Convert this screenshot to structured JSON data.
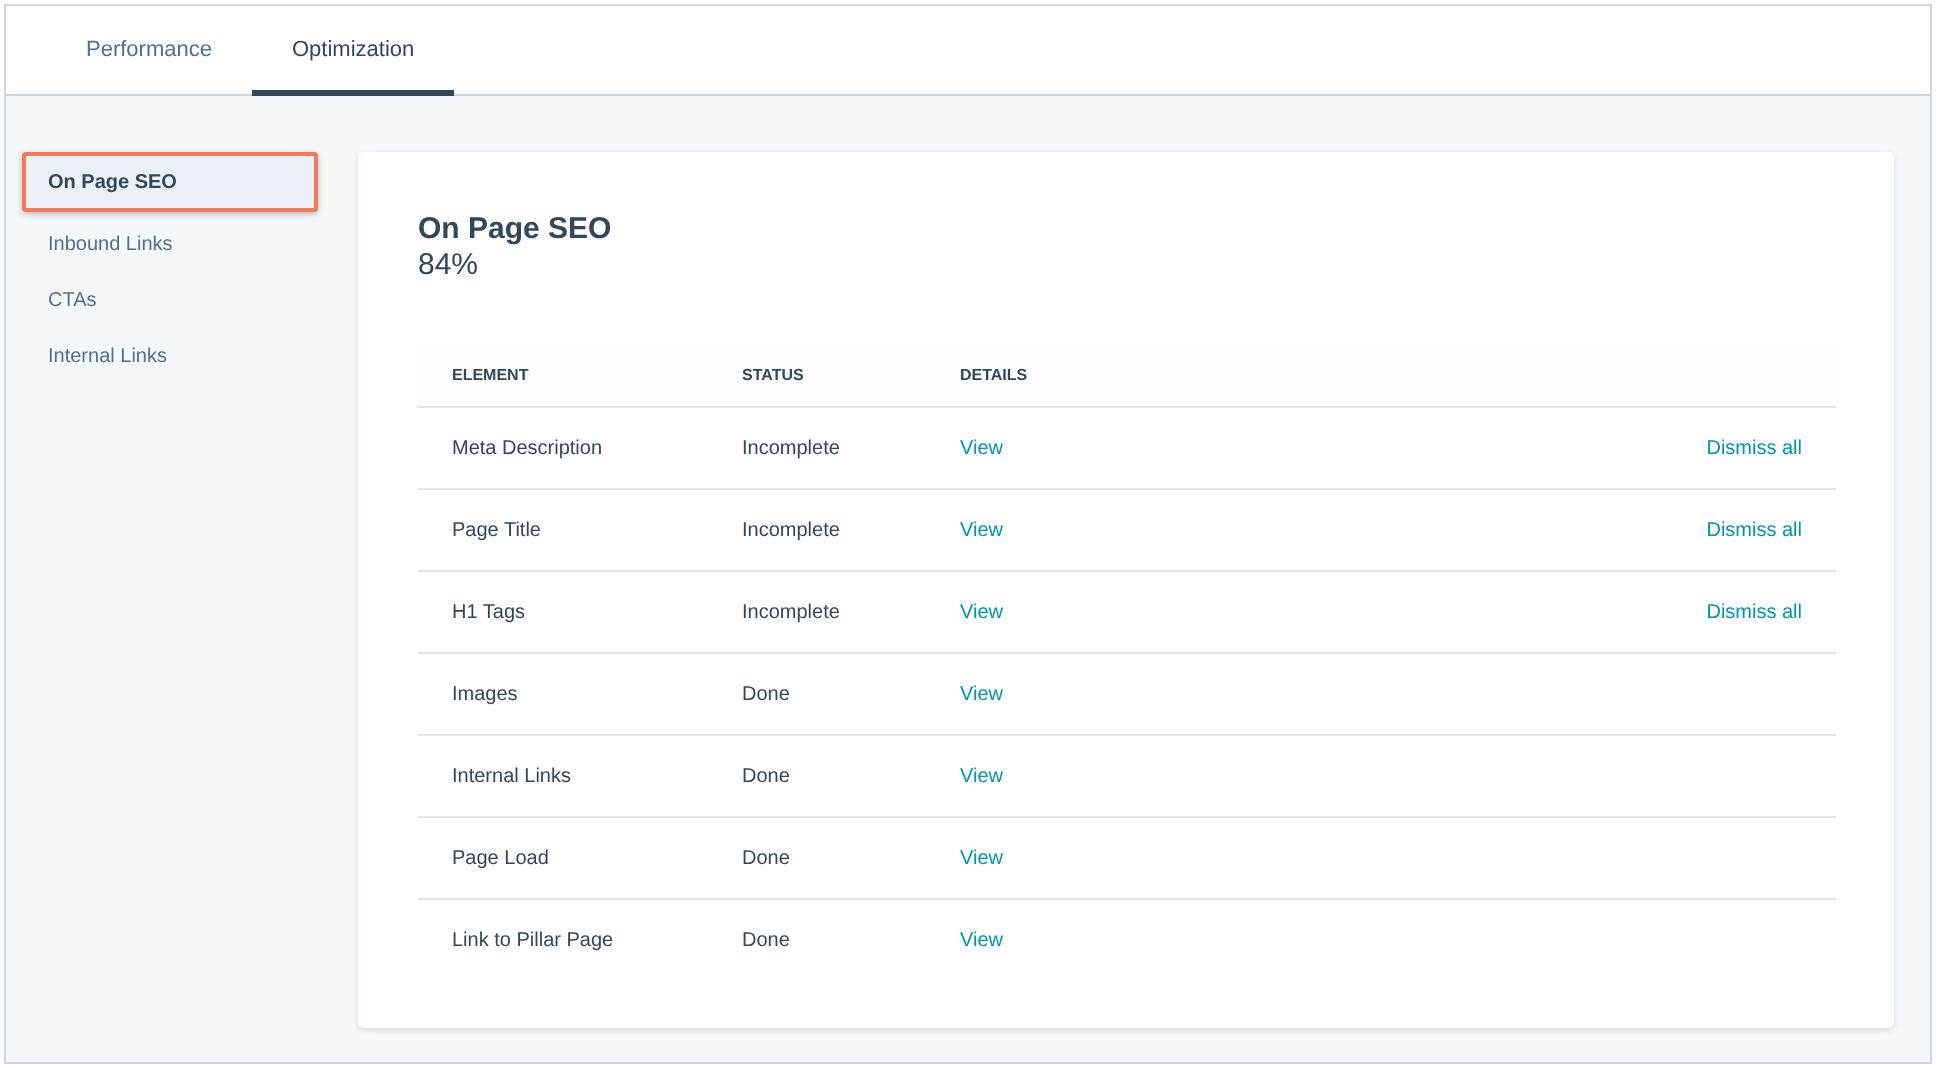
{
  "tabs": [
    {
      "label": "Performance",
      "selected": false
    },
    {
      "label": "Optimization",
      "selected": true
    }
  ],
  "sidebar": {
    "items": [
      {
        "label": "On Page SEO",
        "selected": true
      },
      {
        "label": "Inbound Links",
        "selected": false
      },
      {
        "label": "CTAs",
        "selected": false
      },
      {
        "label": "Internal Links",
        "selected": false
      }
    ]
  },
  "panel": {
    "title": "On Page SEO",
    "score": "84%",
    "table": {
      "columns": [
        "ELEMENT",
        "STATUS",
        "DETAILS"
      ],
      "rows": [
        {
          "element": "Meta Description",
          "status": "Incomplete",
          "details": "View",
          "action": "Dismiss all"
        },
        {
          "element": "Page Title",
          "status": "Incomplete",
          "details": "View",
          "action": "Dismiss all"
        },
        {
          "element": "H1 Tags",
          "status": "Incomplete",
          "details": "View",
          "action": "Dismiss all"
        },
        {
          "element": "Images",
          "status": "Done",
          "details": "View"
        },
        {
          "element": "Internal Links",
          "status": "Done",
          "details": "View"
        },
        {
          "element": "Page Load",
          "status": "Done",
          "details": "View"
        },
        {
          "element": "Link to Pillar Page",
          "status": "Done",
          "details": "View"
        }
      ]
    }
  }
}
